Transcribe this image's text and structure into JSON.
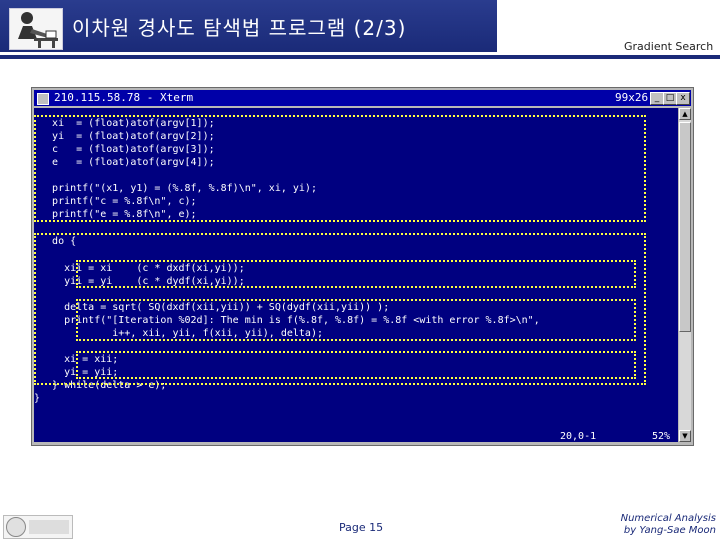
{
  "slide": {
    "title": "이차원 경사도 탐색법 프로그램 (2/3)",
    "subtitle": "Gradient Search",
    "page_label": "Page 15",
    "credit_line1": "Numerical Analysis",
    "credit_line2": "by Yang-Sae Moon",
    "accent_color": "#1a2a78"
  },
  "window": {
    "title": "210.115.58.78 - Xterm",
    "size": "99x26",
    "buttons": [
      "_",
      "□",
      "x"
    ],
    "bg_color": "#000080",
    "highlight_color": "#ffff40"
  },
  "code": {
    "lines": [
      "   xi  = (float)atof(argv[1]);",
      "   yi  = (float)atof(argv[2]);",
      "   c   = (float)atof(argv[3]);",
      "   e   = (float)atof(argv[4]);",
      "",
      "   printf(\"(x1, y1) = (%.8f, %.8f)\\n\", xi, yi);",
      "   printf(\"c = %.8f\\n\", c);",
      "   printf(\"e = %.8f\\n\", e);",
      "",
      "   do {",
      "",
      "     xii = xi    (c * dxdf(xi,yi));",
      "     yii = yi    (c * dydf(xi,yi));",
      "",
      "     delta = sqrt( SQ(dxdf(xii,yii)) + SQ(dydf(xii,yii)) );",
      "     printf(\"[Iteration %02d]: The min is f(%.8f, %.8f) = %.8f <with error %.8f>\\n\",",
      "             i++, xii, yii, f(xii, yii), delta);",
      "",
      "     xi = xii;",
      "     yi = yii;",
      "   } while(delta > e);",
      "}"
    ]
  },
  "status": {
    "position": "20,0-1",
    "percent": "52%"
  },
  "icons": {
    "logo": "professor-at-desk-icon",
    "footer": "university-seal-icon"
  }
}
